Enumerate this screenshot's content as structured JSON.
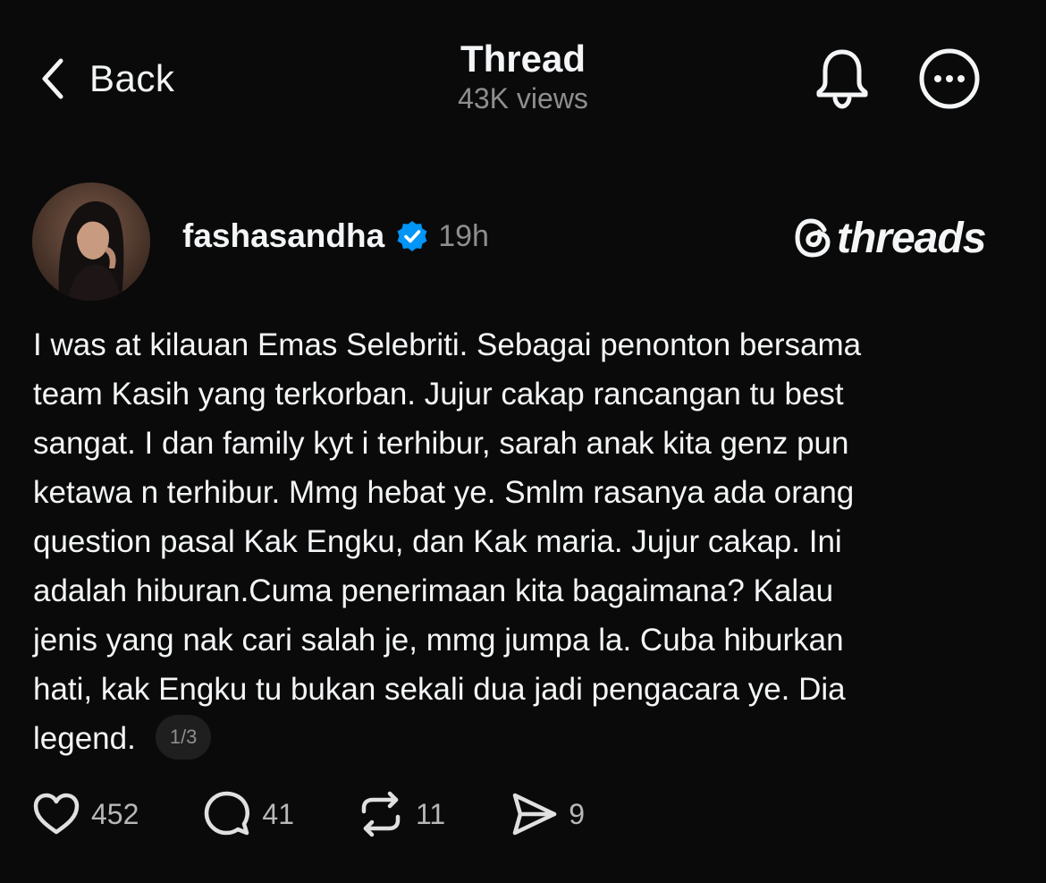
{
  "header": {
    "back_label": "Back",
    "title": "Thread",
    "views": "43K views"
  },
  "post": {
    "username": "fashasandha",
    "time": "19h",
    "brand": "threads",
    "lines": [
      "I was at kilauan Emas Selebriti.  Sebagai penonton bersama",
      "team Kasih yang terkorban. Jujur cakap rancangan tu best",
      "sangat. I dan family kyt i terhibur, sarah anak kita genz pun",
      "ketawa n terhibur. Mmg hebat ye. Smlm rasanya ada orang",
      "question pasal Kak Engku, dan Kak maria. Jujur cakap. Ini",
      "adalah hiburan.Cuma penerimaan kita bagaimana? Kalau",
      "jenis yang nak cari salah je, mmg jumpa la. Cuba hiburkan",
      "hati, kak Engku tu bukan sekali dua jadi pengacara ye. Dia",
      "legend."
    ],
    "page_indicator": "1/3"
  },
  "actions": {
    "likes": "452",
    "replies": "41",
    "reposts": "11",
    "shares": "9"
  },
  "icons": {
    "back": "chevron-left-icon",
    "notifications": "bell-icon",
    "more": "more-horizontal-icon",
    "verified": "verified-badge-icon",
    "like": "heart-icon",
    "reply": "comment-icon",
    "repost": "repost-icon",
    "share": "send-icon"
  },
  "colors": {
    "background": "#0a0a0a",
    "text": "#f3f5f7",
    "muted": "#8e8e8e",
    "verified": "#0095f6"
  }
}
